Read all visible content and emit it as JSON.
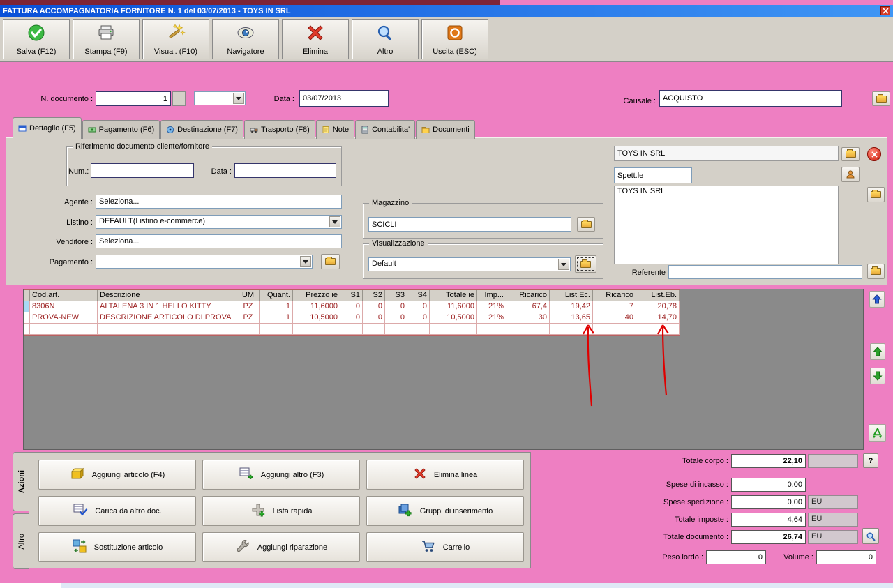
{
  "colors": {
    "window_pink": "#ee7fc2",
    "titlebar_blue": "#0a50d8",
    "panel_gray": "#d4d0c8",
    "grid_area_gray": "#8a8a8a",
    "table_text_red": "#9c2020",
    "annotation_red": "#e00000"
  },
  "window": {
    "title": "FATTURA ACCOMPAGNATORIA FORNITORE N. 1 del 03/07/2013 - TOYS IN SRL"
  },
  "toolbar": {
    "buttons": [
      {
        "label": "Salva (F12)",
        "icon": "green-check-circle-icon"
      },
      {
        "label": "Stampa (F9)",
        "icon": "printer-icon"
      },
      {
        "label": "Visual. (F10)",
        "icon": "magic-wand-icon"
      },
      {
        "label": "Navigatore",
        "icon": "navigator-eye-icon"
      },
      {
        "label": "Elimina",
        "icon": "red-x-icon"
      },
      {
        "label": "Altro",
        "icon": "magnifier-icon"
      },
      {
        "label": "Uscita (ESC)",
        "icon": "orange-power-icon"
      }
    ]
  },
  "document_header": {
    "n_documento_label": "N. documento :",
    "n_documento_value": "1",
    "data_label": "Data :",
    "data_value": "03/07/2013",
    "causale_label": "Causale :",
    "causale_value": "ACQUISTO"
  },
  "tabs": [
    {
      "label": "Dettaglio (F5)",
      "active": true
    },
    {
      "label": "Pagamento (F6)",
      "active": false
    },
    {
      "label": "Destinazione (F7)",
      "active": false
    },
    {
      "label": "Trasporto (F8)",
      "active": false
    },
    {
      "label": "Note",
      "active": false
    },
    {
      "label": "Contabilita'",
      "active": false
    },
    {
      "label": "Documenti",
      "active": false
    }
  ],
  "detail": {
    "rif_group_title": "Riferimento documento cliente/fornitore",
    "num_label": "Num.:",
    "num_value": "",
    "rif_data_label": "Data :",
    "rif_data_value": "",
    "agente_label": "Agente :",
    "agente_value": "Seleziona...",
    "listino_label": "Listino :",
    "listino_value": "DEFAULT(Listino e-commerce)",
    "venditore_label": "Venditore :",
    "venditore_value": "Seleziona...",
    "pagamento_label": "Pagamento :",
    "pagamento_value": "",
    "magazzino_group_title": "Magazzino",
    "magazzino_value": "SCICLI",
    "visualizzazione_group_title": "Visualizzazione",
    "visualizzazione_value": "Default",
    "customer_name": "TOYS IN SRL",
    "spettle_value": "Spett.le",
    "address_text": "TOYS IN SRL",
    "referente_label": "Referente",
    "referente_value": ""
  },
  "table": {
    "columns": [
      "Cod.art.",
      "Descrizione",
      "UM",
      "Quant.",
      "Prezzo ie",
      "S1",
      "S2",
      "S3",
      "S4",
      "Totale ie",
      "Imp...",
      "Ricarico",
      "List.Ec.",
      "Ricarico",
      "List.Eb."
    ],
    "rows": [
      [
        "8306N",
        "ALTALENA 3 IN 1 HELLO KITTY",
        "PZ",
        "1",
        "11,6000",
        "0",
        "0",
        "0",
        "0",
        "11,6000",
        "21%",
        "67,4",
        "19,42",
        "7",
        "20,78"
      ],
      [
        "PROVA-NEW",
        "DESCRIZIONE ARTICOLO DI PROVA",
        "PZ",
        "1",
        "10,5000",
        "0",
        "0",
        "0",
        "0",
        "10,5000",
        "21%",
        "30",
        "13,65",
        "40",
        "14,70"
      ]
    ]
  },
  "annotations": {
    "arrow_color": "#e00000",
    "arrows": [
      "hand-drawn arrow pointing to List.Ec. value 13,65",
      "hand-drawn arrow pointing to List.Eb. value 14,70"
    ]
  },
  "side_buttons": [
    {
      "icon": "blue-arrow-up-icon"
    },
    {
      "icon": "green-arrow-up-icon"
    },
    {
      "icon": "green-arrow-down-icon"
    },
    {
      "icon": "green-recycle-icon"
    }
  ],
  "actions": {
    "tab_azioni_label": "Azioni",
    "tab_altro_label": "Altro",
    "buttons": [
      {
        "label": "Aggiungi articolo (F4)",
        "icon": "yellow-box-icon"
      },
      {
        "label": "Aggiungi altro (F3)",
        "icon": "table-plus-icon"
      },
      {
        "label": "Elimina linea",
        "icon": "red-x-icon"
      },
      {
        "label": "Carica da altro doc.",
        "icon": "table-check-icon"
      },
      {
        "label": "Lista rapida",
        "icon": "list-plus-icon"
      },
      {
        "label": "Gruppi di inserimento",
        "icon": "group-plus-icon"
      },
      {
        "label": "Sostituzione articolo",
        "icon": "swap-boxes-icon"
      },
      {
        "label": "Aggiungi riparazione",
        "icon": "wrench-icon"
      },
      {
        "label": "Carrello",
        "icon": "cart-icon"
      }
    ]
  },
  "totals": {
    "rows": [
      {
        "label": "Totale corpo :",
        "value": "22,10",
        "suffix": ""
      },
      {
        "label": "Spese di incasso :",
        "value": "0,00",
        "suffix": null
      },
      {
        "label": "Spese spedizione :",
        "value": "0,00",
        "suffix": "EU"
      },
      {
        "label": "Totale imposte :",
        "value": "4,64",
        "suffix": "EU"
      },
      {
        "label": "Totale documento :",
        "value": "26,74",
        "suffix": "EU"
      }
    ],
    "help_button_label": "?",
    "peso_lordo_label": "Peso lordo :",
    "peso_lordo_value": "0",
    "volume_label": "Volume :",
    "volume_value": "0"
  }
}
